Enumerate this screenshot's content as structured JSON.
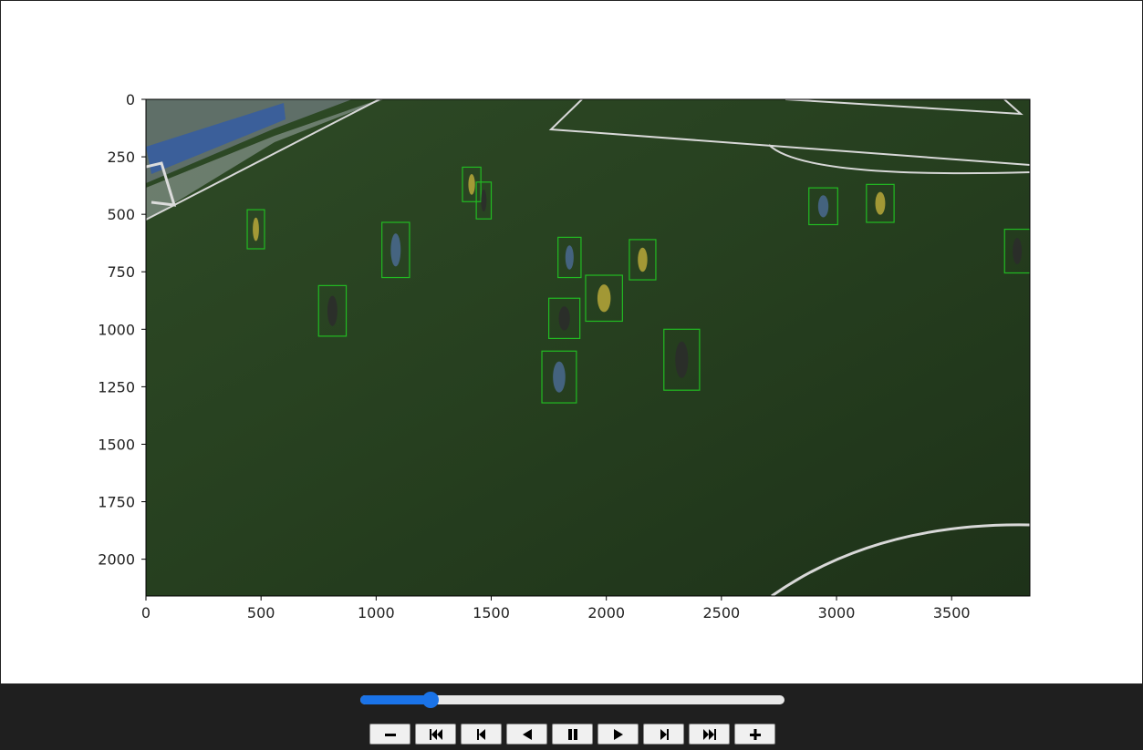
{
  "plot": {
    "image_description": "aerial soccer training frame with player bounding boxes",
    "xlim": [
      0,
      3840
    ],
    "ylim": [
      0,
      2160
    ],
    "x_ticks": [
      "0",
      "500",
      "1000",
      "1500",
      "2000",
      "2500",
      "3000",
      "3500"
    ],
    "x_tick_values": [
      0,
      500,
      1000,
      1500,
      2000,
      2500,
      3000,
      3500
    ],
    "y_ticks": [
      "0",
      "250",
      "500",
      "750",
      "1000",
      "1250",
      "1500",
      "1750",
      "2000"
    ],
    "y_tick_values": [
      0,
      250,
      500,
      750,
      1000,
      1250,
      1500,
      1750,
      2000
    ],
    "box_color": "#22bb22",
    "detections": [
      {
        "x1": 440,
        "y1": 480,
        "x2": 515,
        "y2": 650
      },
      {
        "x1": 750,
        "y1": 810,
        "x2": 870,
        "y2": 1030
      },
      {
        "x1": 1025,
        "y1": 535,
        "x2": 1145,
        "y2": 775
      },
      {
        "x1": 1375,
        "y1": 295,
        "x2": 1455,
        "y2": 445
      },
      {
        "x1": 1435,
        "y1": 360,
        "x2": 1500,
        "y2": 520
      },
      {
        "x1": 1790,
        "y1": 600,
        "x2": 1890,
        "y2": 775
      },
      {
        "x1": 1910,
        "y1": 765,
        "x2": 2070,
        "y2": 965
      },
      {
        "x1": 1750,
        "y1": 865,
        "x2": 1885,
        "y2": 1040
      },
      {
        "x1": 1720,
        "y1": 1095,
        "x2": 1870,
        "y2": 1320
      },
      {
        "x1": 2100,
        "y1": 610,
        "x2": 2215,
        "y2": 785
      },
      {
        "x1": 2250,
        "y1": 1000,
        "x2": 2405,
        "y2": 1265
      },
      {
        "x1": 2880,
        "y1": 385,
        "x2": 3005,
        "y2": 545
      },
      {
        "x1": 3130,
        "y1": 370,
        "x2": 3250,
        "y2": 535
      },
      {
        "x1": 3730,
        "y1": 565,
        "x2": 3840,
        "y2": 755
      }
    ]
  },
  "player": {
    "progress": 0.165,
    "buttons": [
      {
        "name": "decrease-speed-button",
        "icon": "minus-icon"
      },
      {
        "name": "first-frame-button",
        "icon": "skip-to-start-icon"
      },
      {
        "name": "previous-frame-button",
        "icon": "step-back-icon"
      },
      {
        "name": "play-backward-button",
        "icon": "play-reverse-icon"
      },
      {
        "name": "pause-button",
        "icon": "pause-icon"
      },
      {
        "name": "play-forward-button",
        "icon": "play-icon"
      },
      {
        "name": "next-frame-button",
        "icon": "step-forward-icon"
      },
      {
        "name": "last-frame-button",
        "icon": "skip-to-end-icon"
      },
      {
        "name": "increase-speed-button",
        "icon": "plus-icon"
      }
    ]
  }
}
